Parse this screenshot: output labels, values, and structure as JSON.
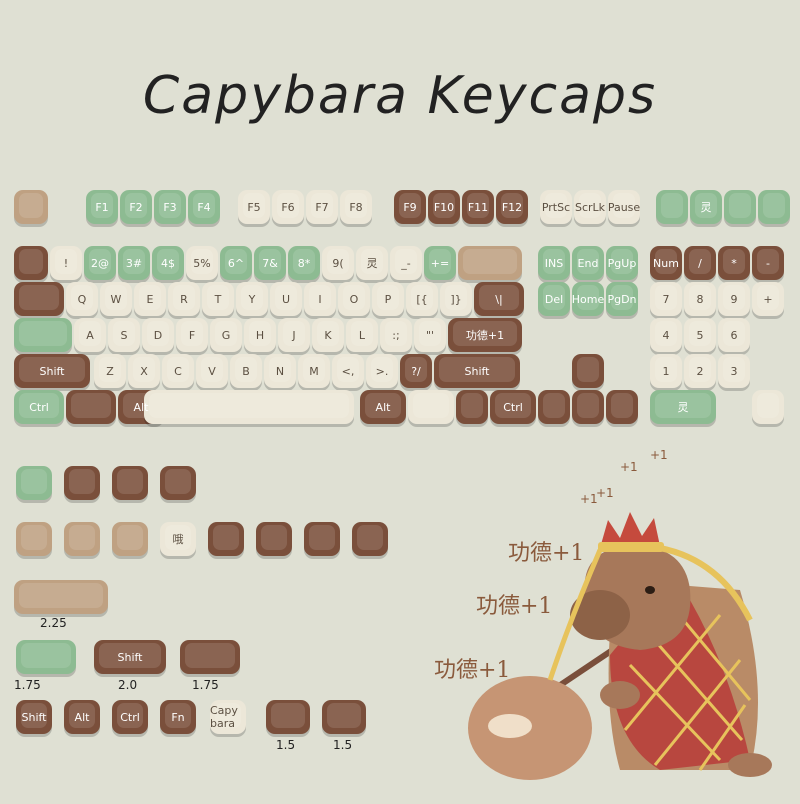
{
  "title": "Capybara Keycaps",
  "keys": [
    {
      "label": "",
      "color": "t"
    },
    {
      "label": "F1",
      "color": "g"
    },
    {
      "label": "F2",
      "color": "g"
    },
    {
      "label": "F3",
      "color": "g"
    },
    {
      "label": "F4",
      "color": "g"
    },
    {
      "label": "F5",
      "color": "c"
    },
    {
      "label": "F6",
      "color": "c"
    },
    {
      "label": "F7",
      "color": "c"
    },
    {
      "label": "F8",
      "color": "c"
    },
    {
      "label": "F9",
      "color": "b"
    },
    {
      "label": "F10",
      "color": "b"
    },
    {
      "label": "F11",
      "color": "b"
    },
    {
      "label": "F12",
      "color": "b"
    },
    {
      "label": "PrtSc",
      "color": "c"
    },
    {
      "label": "ScrLk",
      "color": "c"
    },
    {
      "label": "Pause",
      "color": "c"
    },
    {
      "label": "",
      "color": "g"
    },
    {
      "label": "灵",
      "color": "g"
    },
    {
      "label": "",
      "color": "g"
    },
    {
      "label": "",
      "color": "g"
    },
    {
      "label": "",
      "color": "b"
    },
    {
      "label": "!",
      "color": "c"
    },
    {
      "label": "2@",
      "color": "g"
    },
    {
      "label": "3#",
      "color": "g"
    },
    {
      "label": "4$",
      "color": "g"
    },
    {
      "label": "5%",
      "color": "c"
    },
    {
      "label": "6^",
      "color": "g"
    },
    {
      "label": "7&",
      "color": "g"
    },
    {
      "label": "8*",
      "color": "g"
    },
    {
      "label": "9(",
      "color": "c"
    },
    {
      "label": "灵",
      "color": "c"
    },
    {
      "label": "_-",
      "color": "c"
    },
    {
      "label": "+=",
      "color": "g"
    },
    {
      "label": "",
      "color": "t"
    },
    {
      "label": "INS",
      "color": "g"
    },
    {
      "label": "End",
      "color": "g"
    },
    {
      "label": "PgUp",
      "color": "g"
    },
    {
      "label": "Num",
      "color": "b"
    },
    {
      "label": "/",
      "color": "b"
    },
    {
      "label": "*",
      "color": "b"
    },
    {
      "label": "-",
      "color": "b"
    },
    {
      "label": "",
      "color": "b"
    },
    {
      "label": "Q",
      "color": "c"
    },
    {
      "label": "W",
      "color": "c"
    },
    {
      "label": "E",
      "color": "c"
    },
    {
      "label": "R",
      "color": "c"
    },
    {
      "label": "T",
      "color": "c"
    },
    {
      "label": "Y",
      "color": "c"
    },
    {
      "label": "U",
      "color": "c"
    },
    {
      "label": "I",
      "color": "c"
    },
    {
      "label": "O",
      "color": "c"
    },
    {
      "label": "P",
      "color": "c"
    },
    {
      "label": "[{",
      "color": "c"
    },
    {
      "label": "]}",
      "color": "c"
    },
    {
      "label": "\\|",
      "color": "b"
    },
    {
      "label": "Del",
      "color": "g"
    },
    {
      "label": "Home",
      "color": "g"
    },
    {
      "label": "PgDn",
      "color": "g"
    },
    {
      "label": "7",
      "color": "c"
    },
    {
      "label": "8",
      "color": "c"
    },
    {
      "label": "9",
      "color": "c"
    },
    {
      "label": "+",
      "color": "c"
    },
    {
      "label": "",
      "color": "g"
    },
    {
      "label": "A",
      "color": "c"
    },
    {
      "label": "S",
      "color": "c"
    },
    {
      "label": "D",
      "color": "c"
    },
    {
      "label": "F",
      "color": "c"
    },
    {
      "label": "G",
      "color": "c"
    },
    {
      "label": "H",
      "color": "c"
    },
    {
      "label": "J",
      "color": "c"
    },
    {
      "label": "K",
      "color": "c"
    },
    {
      "label": "L",
      "color": "c"
    },
    {
      "label": ":;",
      "color": "c"
    },
    {
      "label": "\"'",
      "color": "c"
    },
    {
      "label": "功德+1",
      "color": "b"
    },
    {
      "label": "4",
      "color": "c"
    },
    {
      "label": "5",
      "color": "c"
    },
    {
      "label": "6",
      "color": "c"
    },
    {
      "label": "Shift",
      "color": "b"
    },
    {
      "label": "Z",
      "color": "c"
    },
    {
      "label": "X",
      "color": "c"
    },
    {
      "label": "C",
      "color": "c"
    },
    {
      "label": "V",
      "color": "c"
    },
    {
      "label": "B",
      "color": "c"
    },
    {
      "label": "N",
      "color": "c"
    },
    {
      "label": "M",
      "color": "c"
    },
    {
      "label": "<,",
      "color": "c"
    },
    {
      "label": ">.",
      "color": "c"
    },
    {
      "label": "?/",
      "color": "b"
    },
    {
      "label": "Shift",
      "color": "b"
    },
    {
      "label": "",
      "color": "b"
    },
    {
      "label": "1",
      "color": "c"
    },
    {
      "label": "2",
      "color": "c"
    },
    {
      "label": "3",
      "color": "c"
    },
    {
      "label": "Ctrl",
      "color": "g"
    },
    {
      "label": "",
      "color": "b"
    },
    {
      "label": "Alt",
      "color": "b"
    },
    {
      "label": "",
      "color": "c"
    },
    {
      "label": "Alt",
      "color": "b"
    },
    {
      "label": "",
      "color": "c"
    },
    {
      "label": "",
      "color": "b"
    },
    {
      "label": "Ctrl",
      "color": "b"
    },
    {
      "label": "",
      "color": "b"
    },
    {
      "label": "",
      "color": "b"
    },
    {
      "label": "",
      "color": "b"
    },
    {
      "label": "灵",
      "color": "g"
    },
    {
      "label": "",
      "color": "c"
    }
  ],
  "extra_rows": {
    "row1": [
      {
        "label": "",
        "color": "g"
      },
      {
        "label": "",
        "color": "b"
      },
      {
        "label": "",
        "color": "b"
      },
      {
        "label": "",
        "color": "b"
      }
    ],
    "row2": [
      {
        "label": "",
        "color": "t"
      },
      {
        "label": "",
        "color": "t"
      },
      {
        "label": "",
        "color": "t"
      },
      {
        "label": "哦",
        "color": "c"
      },
      {
        "label": "",
        "color": "b"
      },
      {
        "label": "",
        "color": "b"
      },
      {
        "label": "",
        "color": "b"
      },
      {
        "label": "",
        "color": "b"
      }
    ],
    "row3_225": {
      "label": "",
      "color": "t",
      "size": "2.25"
    },
    "row4": [
      {
        "label": "",
        "color": "g",
        "size": "1.75"
      },
      {
        "label": "Shift",
        "color": "b",
        "size": "2.0"
      },
      {
        "label": "",
        "color": "b",
        "size": "1.75"
      }
    ],
    "row5": [
      {
        "label": "Shift",
        "color": "b"
      },
      {
        "label": "Alt",
        "color": "b"
      },
      {
        "label": "Ctrl",
        "color": "b"
      },
      {
        "label": "Fn",
        "color": "b"
      },
      {
        "label": "Capy bara",
        "color": "c"
      },
      {
        "label": "",
        "color": "b",
        "size": "1.5"
      },
      {
        "label": "",
        "color": "b",
        "size": "1.5"
      }
    ]
  },
  "art_text": {
    "merit_1": "功德+1",
    "merit_2": "功德+1",
    "merit_3": "功德+1",
    "plus_1": "+1",
    "plus_2": "+1",
    "plus_3": "+1",
    "plus_4": "+1"
  }
}
